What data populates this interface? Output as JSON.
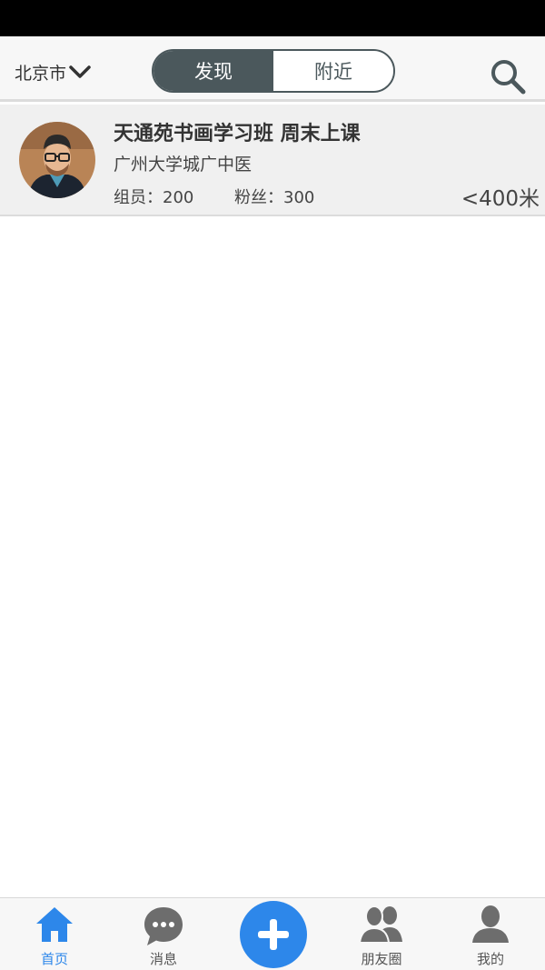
{
  "header": {
    "city": "北京市",
    "tabs": [
      {
        "label": "发现",
        "active": true
      },
      {
        "label": "附近",
        "active": false
      }
    ]
  },
  "groups": [
    {
      "name": "天通苑书画学习班 周末上课",
      "location": "广州大学城广中医",
      "members": "组员：200",
      "fans": "粉丝：300",
      "distance": "<400米"
    }
  ],
  "tabbar": {
    "items": [
      {
        "label": "首页",
        "icon": "home-icon",
        "active": true
      },
      {
        "label": "消息",
        "icon": "chat-bubble-icon",
        "active": false
      },
      {
        "label": "朋友圈",
        "icon": "friends-icon",
        "active": false
      },
      {
        "label": "我的",
        "icon": "person-icon",
        "active": false
      }
    ],
    "center_button_icon": "plus-icon"
  },
  "colors": {
    "accent": "#2d87ea",
    "header_segment": "#4b585c",
    "icon_gray": "#6d6d6d",
    "list_bg": "#f0f0f0"
  }
}
